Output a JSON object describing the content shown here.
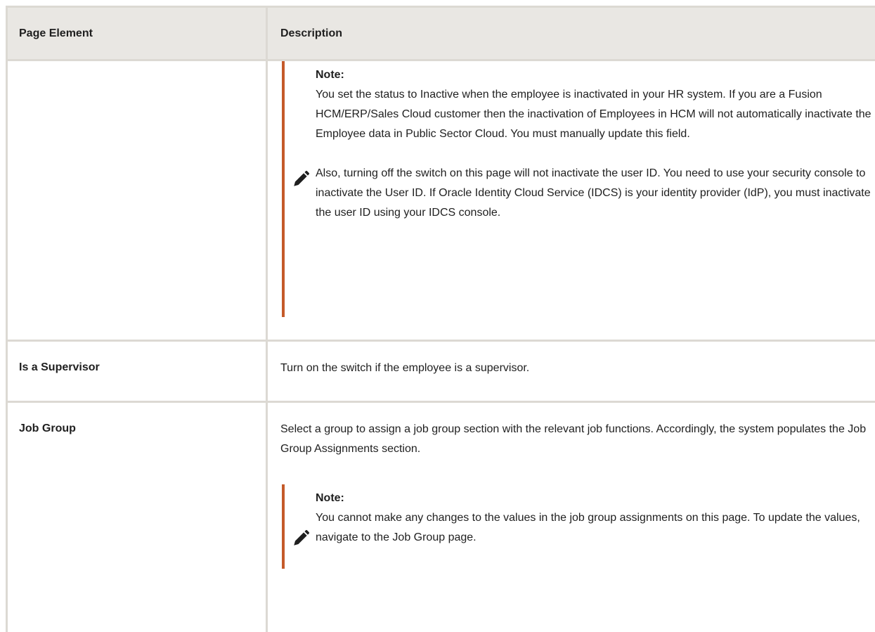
{
  "table": {
    "headers": [
      "Page Element",
      "Description"
    ],
    "rows": [
      {
        "term": "",
        "note": {
          "title": "Note:",
          "paragraph1": "You set the status to Inactive when the employee is inactivated in your HR system. If you are a Fusion HCM/ERP/Sales Cloud customer then the inactivation of Employees in HCM will not automatically inactivate the Employee data in Public Sector Cloud. You must manually update this field.",
          "paragraph2": "Also, turning off the switch on this page will not inactivate the user ID. You need to use your security console to inactivate the User ID. If Oracle Identity Cloud Service (IDCS) is your identity provider (IdP), you must inactivate the user ID using your IDCS console."
        }
      },
      {
        "term": "Is a Supervisor",
        "description": "Turn on the switch if the employee is a supervisor."
      },
      {
        "term": "Job Group",
        "description": "Select a group to assign a job group section with the relevant job functions. Accordingly, the system populates the Job Group Assignments section.",
        "note": {
          "title": "Note:",
          "paragraph1": "You cannot make any changes to the values in the job group assignments on this page. To update the values, navigate to the Job Group page."
        }
      }
    ]
  },
  "icons": {
    "note": "pencil-icon"
  },
  "colors": {
    "note_accent": "#c55a2a",
    "header_bg": "#e9e7e3",
    "border": "#dcd9d3"
  }
}
